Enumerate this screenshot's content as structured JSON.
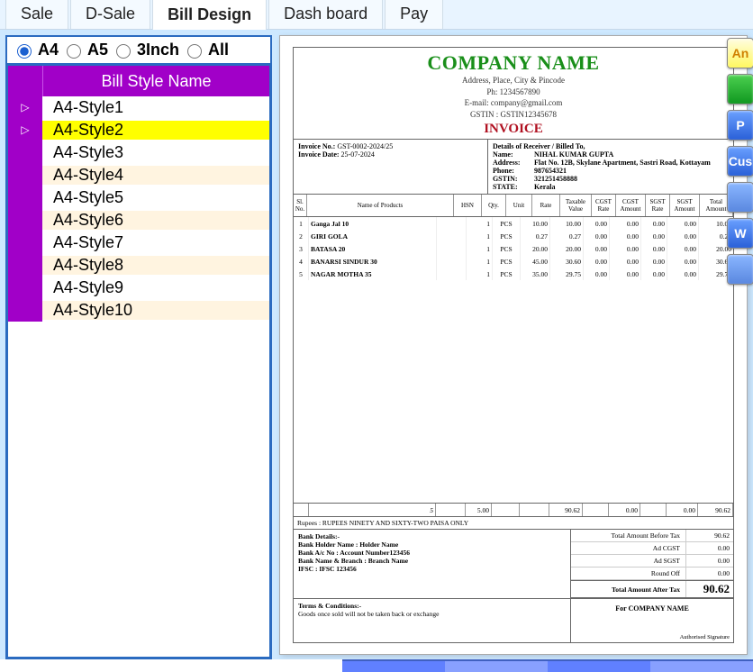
{
  "tabs": [
    {
      "label": "Sale",
      "active": false
    },
    {
      "label": "D-Sale",
      "active": false
    },
    {
      "label": "Bill Design",
      "active": true
    },
    {
      "label": "Dash board",
      "active": false
    },
    {
      "label": "Pay",
      "active": false
    }
  ],
  "radios": [
    {
      "label": "A4",
      "checked": true
    },
    {
      "label": "A5",
      "checked": false
    },
    {
      "label": "3Inch",
      "checked": false
    },
    {
      "label": "All",
      "checked": false
    }
  ],
  "grid": {
    "header": "Bill Style Name",
    "rows": [
      {
        "name": "A4-Style1",
        "current": true
      },
      {
        "name": "A4-Style2",
        "selected": true
      },
      {
        "name": "A4-Style3"
      },
      {
        "name": "A4-Style4"
      },
      {
        "name": "A4-Style5"
      },
      {
        "name": "A4-Style6"
      },
      {
        "name": "A4-Style7"
      },
      {
        "name": "A4-Style8"
      },
      {
        "name": "A4-Style9"
      },
      {
        "name": "A4-Style10"
      }
    ]
  },
  "invoice": {
    "company": "COMPANY NAME",
    "address": "Address, Place, City & Pincode",
    "phone": "Ph: 1234567890",
    "email": "E-mail: company@gmail.com",
    "gstin_top": "GSTIN : GSTIN12345678",
    "title": "INVOICE",
    "inv_no_lbl": "Invoice No.:",
    "inv_no": "GST-0002-2024/25",
    "inv_date_lbl": "Invoice Date:",
    "inv_date": "25-07-2024",
    "recv_title": "Details of Receiver / Billed To,",
    "recv": {
      "name_lbl": "Name:",
      "name": "NIHAL KUMAR GUPTA",
      "addr_lbl": "Address:",
      "addr": "Flat No. 12B, Skylane Apartment, Sastri Road, Kottayam",
      "phone_lbl": "Phone:",
      "phone": "987654321",
      "gstin_lbl": "GSTIN:",
      "gstin": "321251458888",
      "state_lbl": "STATE:",
      "state": "Kerala"
    },
    "cols": {
      "sl": "Sl. No.",
      "name": "Name of Products",
      "hsn": "HSN",
      "qty": "Qty.",
      "unit": "Unit",
      "rate": "Rate",
      "tv": "Taxable Value",
      "cr": "CGST Rate",
      "ca": "CGST Amount",
      "sr": "SGST Rate",
      "sa": "SGST Amount",
      "tot": "Total Amount"
    },
    "items": [
      {
        "sl": "1",
        "name": "Ganga Jal 10",
        "hsn": "",
        "qty": "1",
        "unit": "PCS",
        "rate": "10.00",
        "tv": "10.00",
        "cr": "0.00",
        "ca": "0.00",
        "sr": "0.00",
        "sa": "0.00",
        "tot": "10.00"
      },
      {
        "sl": "2",
        "name": "GIRI GOLA",
        "hsn": "",
        "qty": "1",
        "unit": "PCS",
        "rate": "0.27",
        "tv": "0.27",
        "cr": "0.00",
        "ca": "0.00",
        "sr": "0.00",
        "sa": "0.00",
        "tot": "0.27"
      },
      {
        "sl": "3",
        "name": "BATASA 20",
        "hsn": "",
        "qty": "1",
        "unit": "PCS",
        "rate": "20.00",
        "tv": "20.00",
        "cr": "0.00",
        "ca": "0.00",
        "sr": "0.00",
        "sa": "0.00",
        "tot": "20.00"
      },
      {
        "sl": "4",
        "name": "BANARSI SINDUR 30",
        "hsn": "",
        "qty": "1",
        "unit": "PCS",
        "rate": "45.00",
        "tv": "30.60",
        "cr": "0.00",
        "ca": "0.00",
        "sr": "0.00",
        "sa": "0.00",
        "tot": "30.60"
      },
      {
        "sl": "5",
        "name": "NAGAR MOTHA 35",
        "hsn": "",
        "qty": "1",
        "unit": "PCS",
        "rate": "35.00",
        "tv": "29.75",
        "cr": "0.00",
        "ca": "0.00",
        "sr": "0.00",
        "sa": "0.00",
        "tot": "29.75"
      }
    ],
    "tot_qty": "5.00",
    "tot_tv": "90.62",
    "tot_ca": "0.00",
    "tot_sa": "0.00",
    "tot_amt": "90.62",
    "words_lbl": "Rupees :",
    "words": "RUPEES  NINETY AND SIXTY-TWO PAISA ONLY",
    "bank_title": "Bank Details:-",
    "bank1": "Bank Holder Name : Holder Name",
    "bank2": "Bank A/c No : Account Number123456",
    "bank3": "Bank Name & Branch : Branch Name",
    "bank4": "IFSC : IFSC 123456",
    "sum": {
      "before_lbl": "Total Amount Before Tax",
      "before": "90.62",
      "cgst_lbl": "Ad CGST",
      "cgst": "0.00",
      "sgst_lbl": "Ad SGST",
      "sgst": "0.00",
      "round_lbl": "Round Off",
      "round": "0.00",
      "after_lbl": "Total Amount After Tax",
      "after": "90.62"
    },
    "terms_title": "Terms & Conditions:-",
    "terms": "Goods once sold will not be taken back or exchange",
    "for": "For COMPANY NAME",
    "sig": "Authorised Signature"
  },
  "rbuttons": [
    {
      "label": "An",
      "cls": "b1"
    },
    {
      "label": "",
      "cls": "b2"
    },
    {
      "label": "P",
      "cls": "b3"
    },
    {
      "label": "Cus",
      "cls": "b4"
    },
    {
      "label": "",
      "cls": "b5"
    },
    {
      "label": "W",
      "cls": "b6"
    },
    {
      "label": "",
      "cls": "b7"
    }
  ]
}
